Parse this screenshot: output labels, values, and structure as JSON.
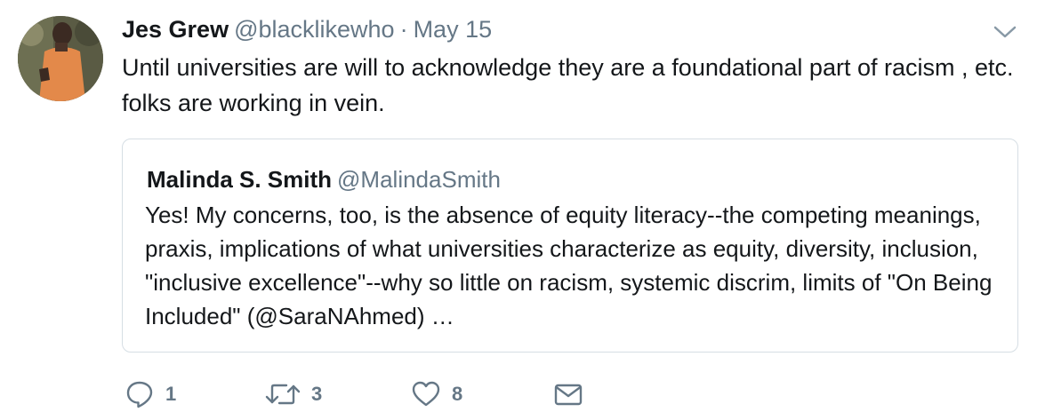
{
  "tweet": {
    "author_name": "Jes Grew",
    "author_handle": "@blacklikewho",
    "separator": "·",
    "date": "May 15",
    "text": "Until universities are will to acknowledge they are a foundational part of racism , etc. folks are working in vein."
  },
  "quoted_tweet": {
    "author_name": "Malinda S. Smith",
    "author_handle": "@MalindaSmith",
    "text": "Yes! My concerns, too, is the absence of equity literacy--the competing meanings, praxis, implications of what universities characterize as equity, diversity, inclusion, \"inclusive excellence\"--why so little on racism, systemic discrim, limits of \"On Being Included\" (@SaraNAhmed) …"
  },
  "actions": {
    "reply": {
      "icon": "reply-icon",
      "count": "1"
    },
    "retweet": {
      "icon": "retweet-icon",
      "count": "3"
    },
    "like": {
      "icon": "heart-icon",
      "count": "8"
    },
    "message": {
      "icon": "envelope-icon"
    }
  },
  "colors": {
    "text": "#14171a",
    "secondary": "#657786",
    "border": "#d6dee4"
  }
}
